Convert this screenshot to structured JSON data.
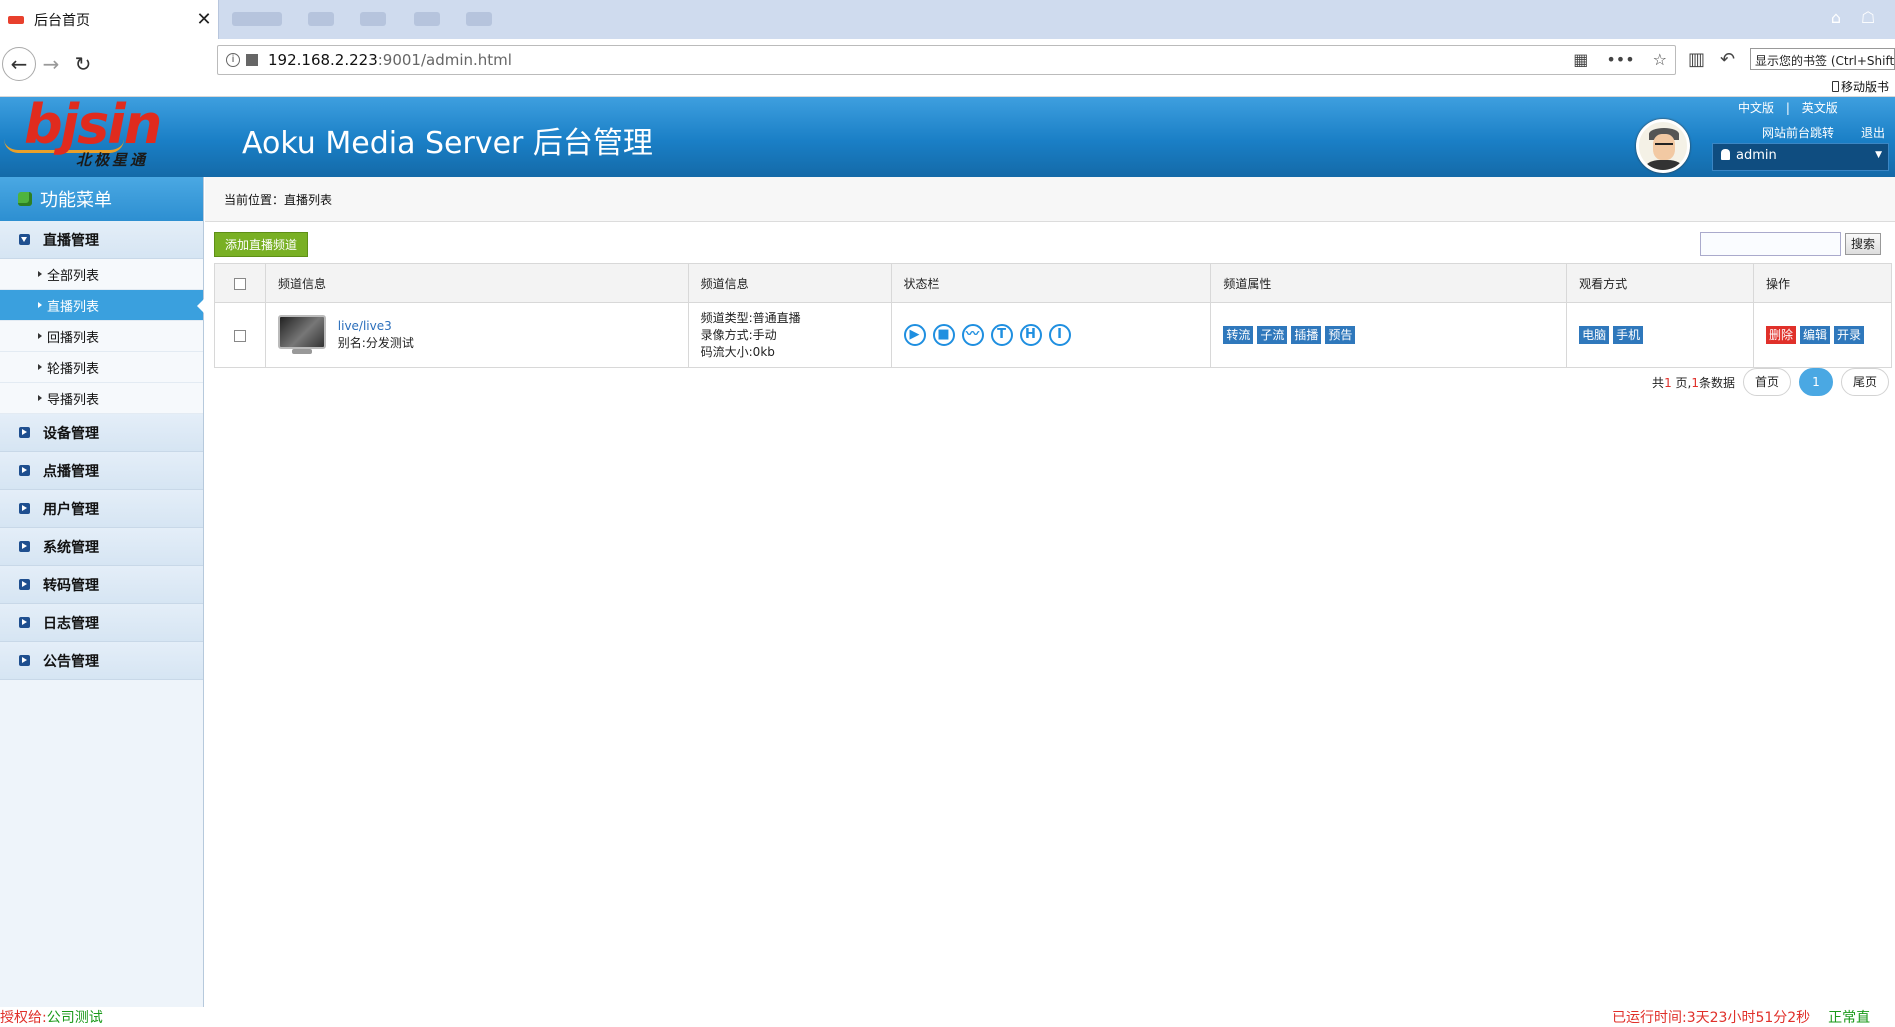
{
  "browser": {
    "tab_title": "后台首页",
    "tab_close": "✕",
    "url_host": "192.168.2.223",
    "url_rest": ":9001/admin.html",
    "bookmark_tip": "显示您的书签 (Ctrl+Shift+",
    "mobile_bookmarks": "移动版书"
  },
  "header": {
    "logo_text": "bjsin",
    "logo_sub": "北极星通",
    "title": "Aoku Media Server 后台管理",
    "lang_zh": "中文版",
    "lang_sep": "|",
    "lang_en": "英文版",
    "front_link": "网站前台跳转",
    "logout": "退出",
    "user": "admin"
  },
  "sidebar": {
    "title": "功能菜单",
    "groups": [
      {
        "label": "直播管理"
      },
      {
        "label": "设备管理"
      },
      {
        "label": "点播管理"
      },
      {
        "label": "用户管理"
      },
      {
        "label": "系统管理"
      },
      {
        "label": "转码管理"
      },
      {
        "label": "日志管理"
      },
      {
        "label": "公告管理"
      }
    ],
    "sub_items": [
      {
        "label": "全部列表"
      },
      {
        "label": "直播列表"
      },
      {
        "label": "回播列表"
      },
      {
        "label": "轮播列表"
      },
      {
        "label": "导播列表"
      }
    ]
  },
  "main": {
    "breadcrumb": "当前位置：直播列表",
    "add_button": "添加直播频道",
    "search_placeholder": "",
    "search_button": "搜索",
    "columns": [
      "频道信息",
      "频道信息",
      "状态栏",
      "频道属性",
      "观看方式",
      "操作"
    ],
    "rows": [
      {
        "stream": "live/live3",
        "alias": "别名:分发测试",
        "info_1": "频道类型:普通直播",
        "info_2": "录像方式:手动",
        "info_3": "码流大小:0kb",
        "status_icons": [
          "▶",
          "■",
          "〰",
          "T",
          "H",
          "I"
        ],
        "attributes": [
          "转流",
          "子流",
          "插播",
          "预告"
        ],
        "watch": [
          "电脑",
          "手机"
        ],
        "actions": [
          "删除",
          "编辑",
          "开录"
        ]
      }
    ],
    "pager": {
      "prefix": "共",
      "pages": "1",
      "mid": " 页,",
      "records": "1",
      "suffix": "条数据",
      "first": "首页",
      "current": "1",
      "last": "尾页"
    }
  },
  "footer": {
    "license_label": "授权给:",
    "license_value": "公司测试",
    "uptime": "已运行时间:3天23小时51分2秒",
    "status": "正常直"
  },
  "colors": {
    "header_blue": "#1a7fc6",
    "accent_green": "#79b024",
    "tag_blue": "#2f78bc",
    "danger_red": "#e0302a"
  }
}
